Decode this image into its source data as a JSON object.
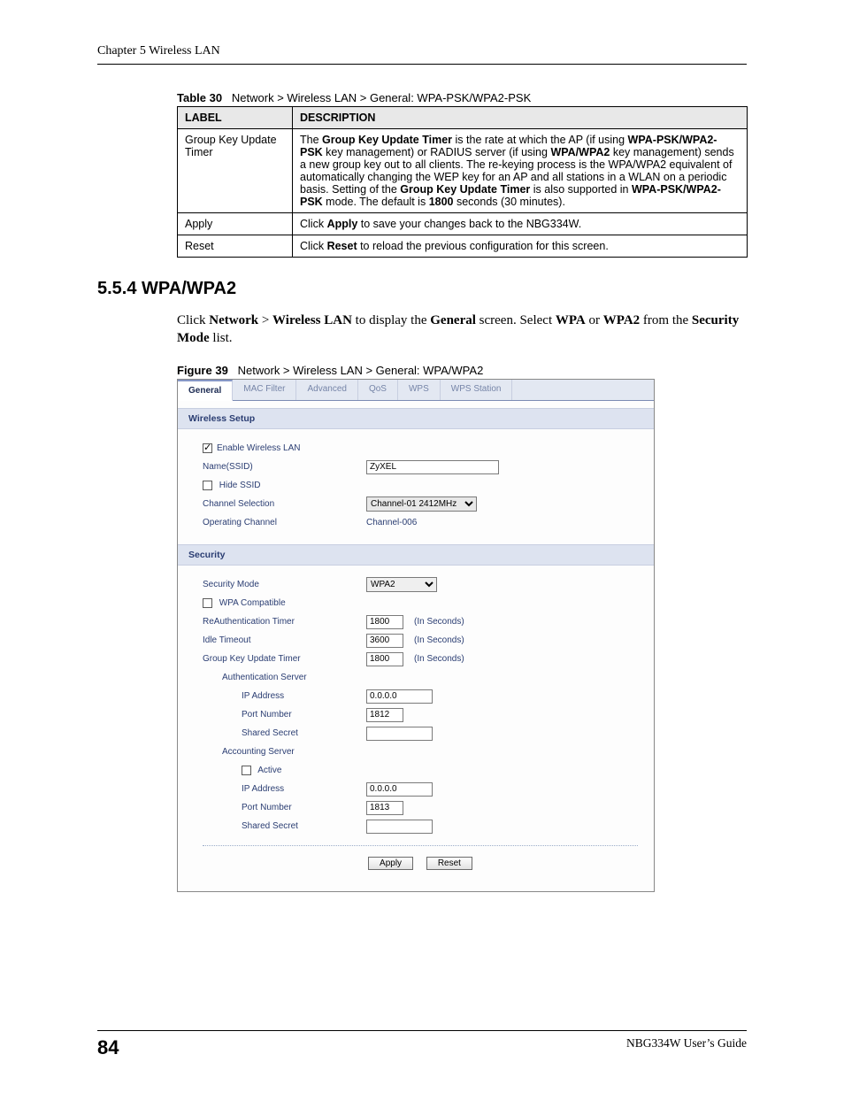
{
  "header": {
    "chapter": "Chapter 5 Wireless LAN"
  },
  "table30": {
    "caption_label": "Table 30",
    "caption_text": "Network > Wireless LAN > General: WPA-PSK/WPA2-PSK",
    "head_label": "LABEL",
    "head_desc": "DESCRIPTION",
    "rows": [
      {
        "label": "Group Key Update Timer",
        "desc_parts": {
          "p1": "The ",
          "b1": "Group Key Update Timer",
          "p2": " is the rate at which the AP (if using ",
          "b2": "WPA-PSK/WPA2-PSK",
          "p3": " key management) or RADIUS server (if using ",
          "b3": "WPA/WPA2",
          "p4": " key management) sends a new group key out to all clients. The re-keying process is the WPA/WPA2 equivalent of automatically changing the WEP key for an AP and all stations in a WLAN on a periodic basis. Setting of the ",
          "b4": "Group Key Update Timer",
          "p5": " is also supported in ",
          "b5": "WPA-PSK/WPA2-PSK",
          "p6": " mode. The default is ",
          "b6": "1800",
          "p7": " seconds (30 minutes)."
        }
      },
      {
        "label": "Apply",
        "desc_parts": {
          "p1": "Click ",
          "b1": "Apply",
          "p2": " to save your changes back to the NBG334W."
        }
      },
      {
        "label": "Reset",
        "desc_parts": {
          "p1": "Click ",
          "b1": "Reset",
          "p2": " to reload the previous configuration for this screen."
        }
      }
    ]
  },
  "section_heading": "5.5.4  WPA/WPA2",
  "para": {
    "p1": "Click ",
    "b1": "Network",
    "p2": " > ",
    "b2": "Wireless LAN",
    "p3": " to display the ",
    "b3": "General",
    "p4": " screen. Select ",
    "b4": "WPA",
    "p5": " or ",
    "b5": "WPA2",
    "p6": " from the ",
    "b6": "Security Mode",
    "p7": " list."
  },
  "figure39": {
    "caption_label": "Figure 39",
    "caption_text": "Network > Wireless LAN > General: WPA/WPA2"
  },
  "screenshot": {
    "tabs": {
      "general": "General",
      "mac_filter": "MAC Filter",
      "advanced": "Advanced",
      "qos": "QoS",
      "wps": "WPS",
      "wps_station": "WPS Station"
    },
    "wireless_setup": {
      "title": "Wireless Setup",
      "enable_wlan": "Enable Wireless LAN",
      "name_ssid_label": "Name(SSID)",
      "name_ssid_value": "ZyXEL",
      "hide_ssid": "Hide SSID",
      "channel_selection_label": "Channel Selection",
      "channel_selection_value": "Channel-01 2412MHz",
      "operating_channel_label": "Operating Channel",
      "operating_channel_value": "Channel-006"
    },
    "security": {
      "title": "Security",
      "security_mode_label": "Security Mode",
      "security_mode_value": "WPA2",
      "wpa_compatible": "WPA Compatible",
      "reauth_timer_label": "ReAuthentication Timer",
      "reauth_timer_value": "1800",
      "idle_timeout_label": "Idle Timeout",
      "idle_timeout_value": "3600",
      "group_key_label": "Group Key Update Timer",
      "group_key_value": "1800",
      "in_seconds": "(In Seconds)",
      "auth_server_label": "Authentication Server",
      "auth_ip_label": "IP Address",
      "auth_ip_value": "0.0.0.0",
      "auth_port_label": "Port Number",
      "auth_port_value": "1812",
      "auth_secret_label": "Shared Secret",
      "acct_server_label": "Accounting Server",
      "acct_active_label": "Active",
      "acct_ip_label": "IP Address",
      "acct_ip_value": "0.0.0.0",
      "acct_port_label": "Port Number",
      "acct_port_value": "1813",
      "acct_secret_label": "Shared Secret"
    },
    "buttons": {
      "apply": "Apply",
      "reset": "Reset"
    }
  },
  "footer": {
    "page": "84",
    "guide": "NBG334W User’s Guide"
  }
}
